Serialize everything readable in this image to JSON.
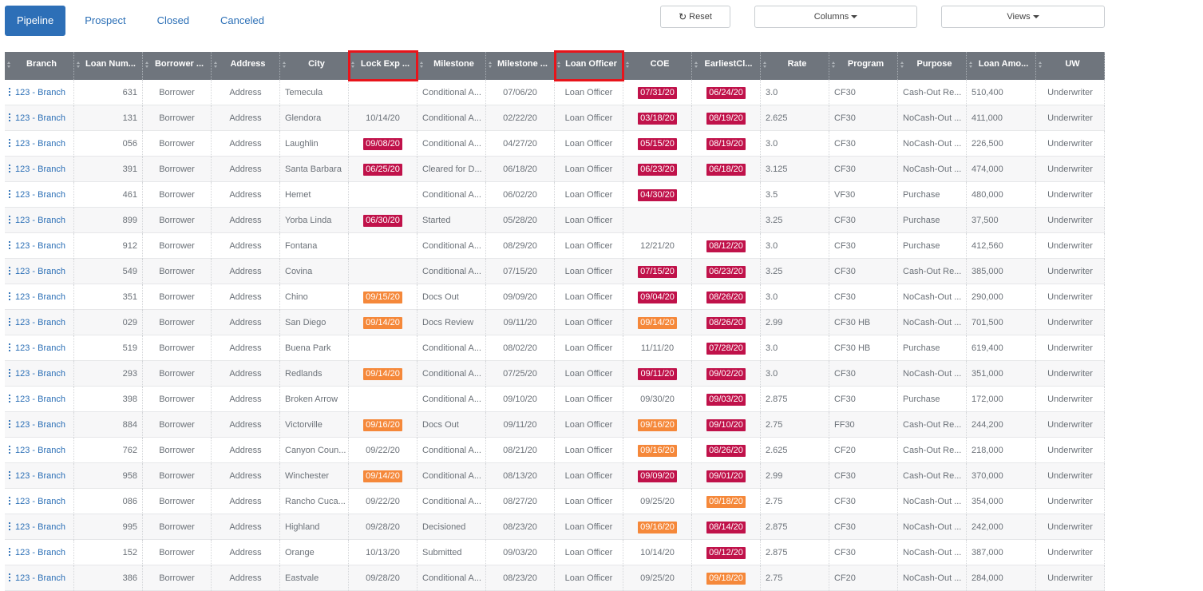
{
  "tabs": [
    {
      "label": "Pipeline",
      "active": true
    },
    {
      "label": "Prospect",
      "active": false
    },
    {
      "label": "Closed",
      "active": false
    },
    {
      "label": "Canceled",
      "active": false
    }
  ],
  "toolbar": {
    "reset_label": "Reset",
    "columns_label": "Columns",
    "views_label": "Views"
  },
  "colors": {
    "accent": "#2d6fb7",
    "header_bg": "#6f757d",
    "badge_red": "#c0124a",
    "badge_orange": "#f5883a",
    "highlight": "#e8141b"
  },
  "grid": {
    "columns": [
      {
        "key": "branch",
        "label": "Branch"
      },
      {
        "key": "loan_num",
        "label": "Loan Num..."
      },
      {
        "key": "borrower",
        "label": "Borrower ..."
      },
      {
        "key": "address",
        "label": "Address"
      },
      {
        "key": "city",
        "label": "City"
      },
      {
        "key": "lock_exp",
        "label": "Lock Exp ..."
      },
      {
        "key": "milestone",
        "label": "Milestone"
      },
      {
        "key": "milestone_date",
        "label": "Milestone ..."
      },
      {
        "key": "loan_officer",
        "label": "Loan Officer"
      },
      {
        "key": "coe",
        "label": "COE"
      },
      {
        "key": "earliest_close",
        "label": "EarliestCl..."
      },
      {
        "key": "rate",
        "label": "Rate"
      },
      {
        "key": "program",
        "label": "Program"
      },
      {
        "key": "purpose",
        "label": "Purpose"
      },
      {
        "key": "loan_amount",
        "label": "Loan Amo..."
      },
      {
        "key": "uw",
        "label": "UW"
      }
    ],
    "highlighted_columns": [
      "lock_exp",
      "loan_officer"
    ],
    "rows": [
      {
        "branch": "123 - Branch",
        "loan_num": "631",
        "borrower": "Borrower",
        "address": "Address",
        "city": "Temecula",
        "lock_exp": {
          "text": "",
          "status": "none"
        },
        "milestone": "Conditional A...",
        "milestone_date": "07/06/20",
        "loan_officer": "Loan Officer",
        "coe": {
          "text": "07/31/20",
          "status": "red"
        },
        "earliest_close": {
          "text": "06/24/20",
          "status": "red"
        },
        "rate": "3.0",
        "program": "CF30",
        "purpose": "Cash-Out Re...",
        "loan_amount": "510,400",
        "uw": "Underwriter"
      },
      {
        "branch": "123 - Branch",
        "loan_num": "131",
        "borrower": "Borrower",
        "address": "Address",
        "city": "Glendora",
        "lock_exp": {
          "text": "10/14/20",
          "status": "none"
        },
        "milestone": "Conditional A...",
        "milestone_date": "02/22/20",
        "loan_officer": "Loan Officer",
        "coe": {
          "text": "03/18/20",
          "status": "red"
        },
        "earliest_close": {
          "text": "08/19/20",
          "status": "red"
        },
        "rate": "2.625",
        "program": "CF30",
        "purpose": "NoCash-Out ...",
        "loan_amount": "411,000",
        "uw": "Underwriter"
      },
      {
        "branch": "123 - Branch",
        "loan_num": "056",
        "borrower": "Borrower",
        "address": "Address",
        "city": "Laughlin",
        "lock_exp": {
          "text": "09/08/20",
          "status": "red"
        },
        "milestone": "Conditional A...",
        "milestone_date": "04/27/20",
        "loan_officer": "Loan Officer",
        "coe": {
          "text": "05/15/20",
          "status": "red"
        },
        "earliest_close": {
          "text": "08/19/20",
          "status": "red"
        },
        "rate": "3.0",
        "program": "CF30",
        "purpose": "NoCash-Out ...",
        "loan_amount": "226,500",
        "uw": "Underwriter"
      },
      {
        "branch": "123 - Branch",
        "loan_num": "391",
        "borrower": "Borrower",
        "address": "Address",
        "city": "Santa Barbara",
        "lock_exp": {
          "text": "06/25/20",
          "status": "red"
        },
        "milestone": "Cleared for D...",
        "milestone_date": "06/18/20",
        "loan_officer": "Loan Officer",
        "coe": {
          "text": "06/23/20",
          "status": "red"
        },
        "earliest_close": {
          "text": "06/18/20",
          "status": "red"
        },
        "rate": "3.125",
        "program": "CF30",
        "purpose": "NoCash-Out ...",
        "loan_amount": "474,000",
        "uw": "Underwriter"
      },
      {
        "branch": "123 - Branch",
        "loan_num": "461",
        "borrower": "Borrower",
        "address": "Address",
        "city": "Hemet",
        "lock_exp": {
          "text": "",
          "status": "none"
        },
        "milestone": "Conditional A...",
        "milestone_date": "06/02/20",
        "loan_officer": "Loan Officer",
        "coe": {
          "text": "04/30/20",
          "status": "red"
        },
        "earliest_close": {
          "text": "",
          "status": "none"
        },
        "rate": "3.5",
        "program": "VF30",
        "purpose": "Purchase",
        "loan_amount": "480,000",
        "uw": "Underwriter"
      },
      {
        "branch": "123 - Branch",
        "loan_num": "899",
        "borrower": "Borrower",
        "address": "Address",
        "city": "Yorba Linda",
        "lock_exp": {
          "text": "06/30/20",
          "status": "red"
        },
        "milestone": "Started",
        "milestone_date": "05/28/20",
        "loan_officer": "Loan Officer",
        "coe": {
          "text": "",
          "status": "none"
        },
        "earliest_close": {
          "text": "",
          "status": "none"
        },
        "rate": "3.25",
        "program": "CF30",
        "purpose": "Purchase",
        "loan_amount": "37,500",
        "uw": "Underwriter"
      },
      {
        "branch": "123 - Branch",
        "loan_num": "912",
        "borrower": "Borrower",
        "address": "Address",
        "city": "Fontana",
        "lock_exp": {
          "text": "",
          "status": "none"
        },
        "milestone": "Conditional A...",
        "milestone_date": "08/29/20",
        "loan_officer": "Loan Officer",
        "coe": {
          "text": "12/21/20",
          "status": "none"
        },
        "earliest_close": {
          "text": "08/12/20",
          "status": "red"
        },
        "rate": "3.0",
        "program": "CF30",
        "purpose": "Purchase",
        "loan_amount": "412,560",
        "uw": "Underwriter"
      },
      {
        "branch": "123 - Branch",
        "loan_num": "549",
        "borrower": "Borrower",
        "address": "Address",
        "city": "Covina",
        "lock_exp": {
          "text": "",
          "status": "none"
        },
        "milestone": "Conditional A...",
        "milestone_date": "07/15/20",
        "loan_officer": "Loan Officer",
        "coe": {
          "text": "07/15/20",
          "status": "red"
        },
        "earliest_close": {
          "text": "06/23/20",
          "status": "red"
        },
        "rate": "3.25",
        "program": "CF30",
        "purpose": "Cash-Out Re...",
        "loan_amount": "385,000",
        "uw": "Underwriter"
      },
      {
        "branch": "123 - Branch",
        "loan_num": "351",
        "borrower": "Borrower",
        "address": "Address",
        "city": "Chino",
        "lock_exp": {
          "text": "09/15/20",
          "status": "orange"
        },
        "milestone": "Docs Out",
        "milestone_date": "09/09/20",
        "loan_officer": "Loan Officer",
        "coe": {
          "text": "09/04/20",
          "status": "red"
        },
        "earliest_close": {
          "text": "08/26/20",
          "status": "red"
        },
        "rate": "3.0",
        "program": "CF30",
        "purpose": "NoCash-Out ...",
        "loan_amount": "290,000",
        "uw": "Underwriter"
      },
      {
        "branch": "123 - Branch",
        "loan_num": "029",
        "borrower": "Borrower",
        "address": "Address",
        "city": "San Diego",
        "lock_exp": {
          "text": "09/14/20",
          "status": "orange"
        },
        "milestone": "Docs Review",
        "milestone_date": "09/11/20",
        "loan_officer": "Loan Officer",
        "coe": {
          "text": "09/14/20",
          "status": "orange"
        },
        "earliest_close": {
          "text": "08/26/20",
          "status": "red"
        },
        "rate": "2.99",
        "program": "CF30 HB",
        "purpose": "NoCash-Out ...",
        "loan_amount": "701,500",
        "uw": "Underwriter"
      },
      {
        "branch": "123 - Branch",
        "loan_num": "519",
        "borrower": "Borrower",
        "address": "Address",
        "city": "Buena Park",
        "lock_exp": {
          "text": "",
          "status": "none"
        },
        "milestone": "Conditional A...",
        "milestone_date": "08/02/20",
        "loan_officer": "Loan Officer",
        "coe": {
          "text": "11/11/20",
          "status": "none"
        },
        "earliest_close": {
          "text": "07/28/20",
          "status": "red"
        },
        "rate": "3.0",
        "program": "CF30 HB",
        "purpose": "Purchase",
        "loan_amount": "619,400",
        "uw": "Underwriter"
      },
      {
        "branch": "123 - Branch",
        "loan_num": "293",
        "borrower": "Borrower",
        "address": "Address",
        "city": "Redlands",
        "lock_exp": {
          "text": "09/14/20",
          "status": "orange"
        },
        "milestone": "Conditional A...",
        "milestone_date": "07/25/20",
        "loan_officer": "Loan Officer",
        "coe": {
          "text": "09/11/20",
          "status": "red"
        },
        "earliest_close": {
          "text": "09/02/20",
          "status": "red"
        },
        "rate": "3.0",
        "program": "CF30",
        "purpose": "NoCash-Out ...",
        "loan_amount": "351,000",
        "uw": "Underwriter"
      },
      {
        "branch": "123 - Branch",
        "loan_num": "398",
        "borrower": "Borrower",
        "address": "Address",
        "city": "Broken Arrow",
        "lock_exp": {
          "text": "",
          "status": "none"
        },
        "milestone": "Conditional A...",
        "milestone_date": "09/10/20",
        "loan_officer": "Loan Officer",
        "coe": {
          "text": "09/30/20",
          "status": "none"
        },
        "earliest_close": {
          "text": "09/03/20",
          "status": "red"
        },
        "rate": "2.875",
        "program": "CF30",
        "purpose": "Purchase",
        "loan_amount": "172,000",
        "uw": "Underwriter"
      },
      {
        "branch": "123 - Branch",
        "loan_num": "884",
        "borrower": "Borrower",
        "address": "Address",
        "city": "Victorville",
        "lock_exp": {
          "text": "09/16/20",
          "status": "orange"
        },
        "milestone": "Docs Out",
        "milestone_date": "09/11/20",
        "loan_officer": "Loan Officer",
        "coe": {
          "text": "09/16/20",
          "status": "orange"
        },
        "earliest_close": {
          "text": "09/10/20",
          "status": "red"
        },
        "rate": "2.75",
        "program": "FF30",
        "purpose": "Cash-Out Re...",
        "loan_amount": "244,200",
        "uw": "Underwriter"
      },
      {
        "branch": "123 - Branch",
        "loan_num": "762",
        "borrower": "Borrower",
        "address": "Address",
        "city": "Canyon Coun...",
        "lock_exp": {
          "text": "09/22/20",
          "status": "none"
        },
        "milestone": "Conditional A...",
        "milestone_date": "08/21/20",
        "loan_officer": "Loan Officer",
        "coe": {
          "text": "09/16/20",
          "status": "orange"
        },
        "earliest_close": {
          "text": "08/26/20",
          "status": "red"
        },
        "rate": "2.625",
        "program": "CF20",
        "purpose": "Cash-Out Re...",
        "loan_amount": "218,000",
        "uw": "Underwriter"
      },
      {
        "branch": "123 - Branch",
        "loan_num": "958",
        "borrower": "Borrower",
        "address": "Address",
        "city": "Winchester",
        "lock_exp": {
          "text": "09/14/20",
          "status": "orange"
        },
        "milestone": "Conditional A...",
        "milestone_date": "08/13/20",
        "loan_officer": "Loan Officer",
        "coe": {
          "text": "09/09/20",
          "status": "red"
        },
        "earliest_close": {
          "text": "09/01/20",
          "status": "red"
        },
        "rate": "2.99",
        "program": "CF30",
        "purpose": "Cash-Out Re...",
        "loan_amount": "370,000",
        "uw": "Underwriter"
      },
      {
        "branch": "123 - Branch",
        "loan_num": "086",
        "borrower": "Borrower",
        "address": "Address",
        "city": "Rancho Cuca...",
        "lock_exp": {
          "text": "09/22/20",
          "status": "none"
        },
        "milestone": "Conditional A...",
        "milestone_date": "08/27/20",
        "loan_officer": "Loan Officer",
        "coe": {
          "text": "09/25/20",
          "status": "none"
        },
        "earliest_close": {
          "text": "09/18/20",
          "status": "orange"
        },
        "rate": "2.75",
        "program": "CF30",
        "purpose": "NoCash-Out ...",
        "loan_amount": "354,000",
        "uw": "Underwriter"
      },
      {
        "branch": "123 - Branch",
        "loan_num": "995",
        "borrower": "Borrower",
        "address": "Address",
        "city": "Highland",
        "lock_exp": {
          "text": "09/28/20",
          "status": "none"
        },
        "milestone": "Decisioned",
        "milestone_date": "08/23/20",
        "loan_officer": "Loan Officer",
        "coe": {
          "text": "09/16/20",
          "status": "orange"
        },
        "earliest_close": {
          "text": "08/14/20",
          "status": "red"
        },
        "rate": "2.875",
        "program": "CF30",
        "purpose": "NoCash-Out ...",
        "loan_amount": "242,000",
        "uw": "Underwriter"
      },
      {
        "branch": "123 - Branch",
        "loan_num": "152",
        "borrower": "Borrower",
        "address": "Address",
        "city": "Orange",
        "lock_exp": {
          "text": "10/13/20",
          "status": "none"
        },
        "milestone": "Submitted",
        "milestone_date": "09/03/20",
        "loan_officer": "Loan Officer",
        "coe": {
          "text": "10/14/20",
          "status": "none"
        },
        "earliest_close": {
          "text": "09/12/20",
          "status": "red"
        },
        "rate": "2.875",
        "program": "CF30",
        "purpose": "NoCash-Out ...",
        "loan_amount": "387,000",
        "uw": "Underwriter"
      },
      {
        "branch": "123 - Branch",
        "loan_num": "386",
        "borrower": "Borrower",
        "address": "Address",
        "city": "Eastvale",
        "lock_exp": {
          "text": "09/28/20",
          "status": "none"
        },
        "milestone": "Conditional A...",
        "milestone_date": "08/23/20",
        "loan_officer": "Loan Officer",
        "coe": {
          "text": "09/25/20",
          "status": "none"
        },
        "earliest_close": {
          "text": "09/18/20",
          "status": "orange"
        },
        "rate": "2.75",
        "program": "CF20",
        "purpose": "NoCash-Out ...",
        "loan_amount": "284,000",
        "uw": "Underwriter"
      }
    ]
  }
}
